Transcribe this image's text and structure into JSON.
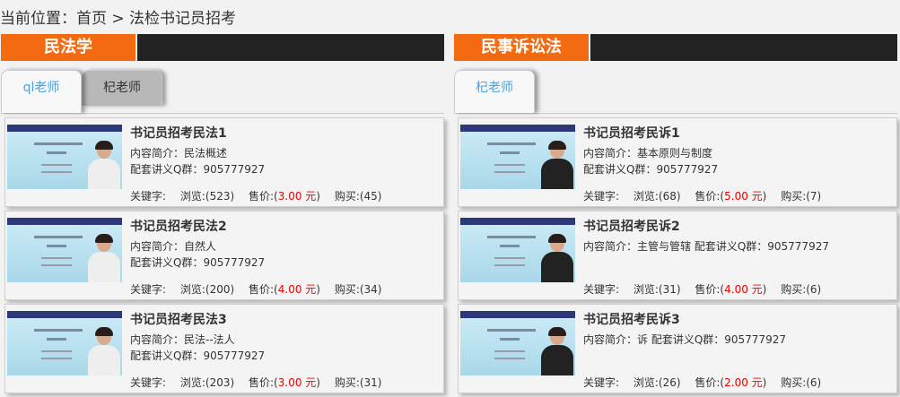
{
  "breadcrumb": "当前位置：首页 > 法检书记员招考",
  "sections": [
    {
      "title": "民法学",
      "tabs": [
        {
          "label": "ql老师",
          "active": true
        },
        {
          "label": "杞老师",
          "active": false
        }
      ],
      "items": [
        {
          "title": "书记员招考民法1",
          "desc1": "内容简介：民法概述",
          "desc2": "配套讲义Q群：905777927",
          "keyword": "关键字:",
          "views": "浏览:(523)",
          "price_label": "售价:(",
          "price": "3.00 元",
          "price_end": ")",
          "buys": "购买:(45)",
          "body": "light"
        },
        {
          "title": "书记员招考民法2",
          "desc1": "内容简介：自然人",
          "desc2": "配套讲义Q群：905777927",
          "keyword": "关键字:",
          "views": "浏览:(200)",
          "price_label": "售价:(",
          "price": "4.00 元",
          "price_end": ")",
          "buys": "购买:(34)",
          "body": "light"
        },
        {
          "title": "书记员招考民法3",
          "desc1": "内容简介：民法--法人",
          "desc2": "配套讲义Q群：905777927",
          "keyword": "关键字:",
          "views": "浏览:(203)",
          "price_label": "售价:(",
          "price": "3.00 元",
          "price_end": ")",
          "buys": "购买:(31)",
          "body": "light"
        }
      ]
    },
    {
      "title": "民事诉讼法",
      "tabs": [
        {
          "label": "杞老师",
          "active": true
        }
      ],
      "items": [
        {
          "title": "书记员招考民诉1",
          "desc1": "内容简介：基本原则与制度",
          "desc2": "配套讲义Q群：905777927",
          "keyword": "关键字:",
          "views": "浏览:(68)",
          "price_label": "售价:(",
          "price": "5.00 元",
          "price_end": ")",
          "buys": "购买:(7)",
          "body": "dark"
        },
        {
          "title": "书记员招考民诉2",
          "desc1": "内容简介：主管与管辖 配套讲义Q群：905777927",
          "desc2": "",
          "keyword": "关键字:",
          "views": "浏览:(31)",
          "price_label": "售价:(",
          "price": "4.00 元",
          "price_end": ")",
          "buys": "购买:(6)",
          "body": "dark"
        },
        {
          "title": "书记员招考民诉3",
          "desc1": "内容简介：诉 配套讲义Q群：905777927",
          "desc2": "",
          "keyword": "关键字:",
          "views": "浏览:(26)",
          "price_label": "售价:(",
          "price": "2.00 元",
          "price_end": ")",
          "buys": "购买:(6)",
          "body": "dark"
        }
      ]
    }
  ],
  "colors": {
    "accent": "#f46a10",
    "header_dark": "#222222",
    "tab_active_text": "#4aa3df",
    "price": "#ee0000"
  }
}
